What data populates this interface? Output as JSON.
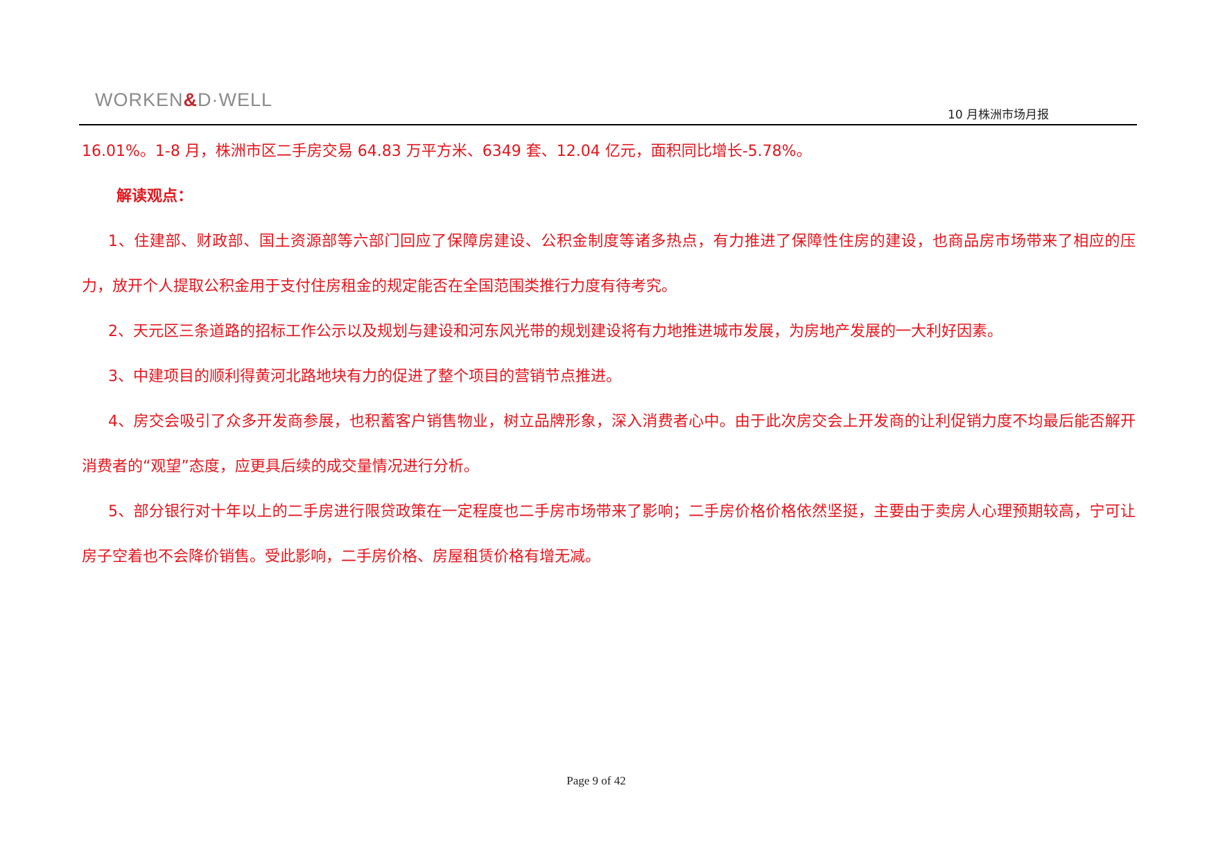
{
  "header": {
    "logo_left": "WORKEN",
    "logo_amp": "&",
    "logo_right": "D·WELL",
    "report_title": "10 月株洲市场月报"
  },
  "content": {
    "paragraphs": [
      "16.01%。1-8 月，株洲市区二手房交易 64.83 万平方米、6349 套、12.04 亿元，面积同比增长-5.78%。",
      "解读观点：",
      "1、住建部、财政部、国土资源部等六部门回应了保障房建设、公积金制度等诸多热点，有力推进了保障性住房的建设，也商品房市场带来了相应的压力，放开个人提取公积金用于支付住房租金的规定能否在全国范围类推行力度有待考究。",
      "2、天元区三条道路的招标工作公示以及规划与建设和河东风光带的规划建设将有力地推进城市发展，为房地产发展的一大利好因素。",
      "3、中建项目的顺利得黄河北路地块有力的促进了整个项目的营销节点推进。",
      "4、房交会吸引了众多开发商参展，也积蓄客户销售物业，树立品牌形象，深入消费者心中。由于此次房交会上开发商的让利促销力度不均最后能否解开消费者的“观望”态度，应更具后续的成交量情况进行分析。",
      "5、部分银行对十年以上的二手房进行限贷政策在一定程度也二手房市场带来了影响；二手房价格价格依然坚挺，主要由于卖房人心理预期较高，宁可让房子空着也不会降价销售。受此影响，二手房价格、房屋租赁价格有增无减。"
    ]
  },
  "footer": {
    "page_label": "Page 9 of 42"
  },
  "colors": {
    "body_text": "#e3161d",
    "logo_gray": "#8a8a8a",
    "logo_accent": "#c0262d"
  }
}
